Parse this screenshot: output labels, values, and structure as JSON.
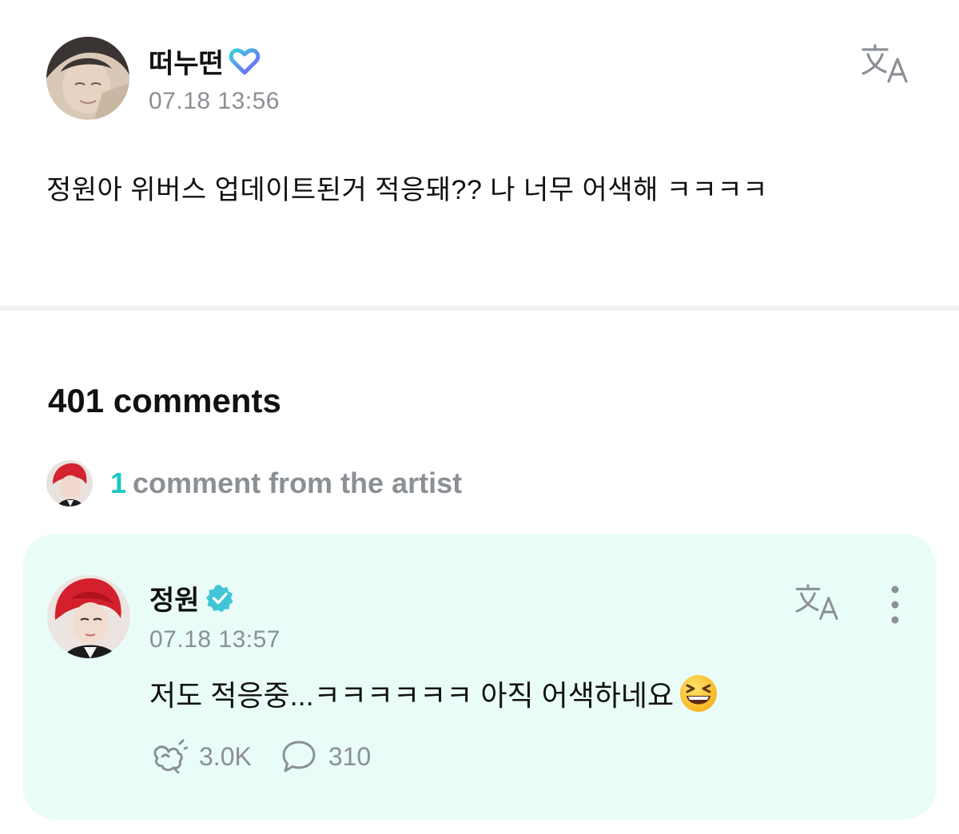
{
  "post": {
    "author": "떠누떤",
    "author_badge": "weverse-heart-icon",
    "time": "07.18 13:56",
    "body": "정원아 위버스 업데이트된거 적응돼?? 나 너무 어색해 ㅋㅋㅋㅋ",
    "translate_icon": "translate-icon"
  },
  "comments_section": {
    "count_label": "401 comments",
    "artist_summary": {
      "count": "1",
      "text": "comment from the artist"
    }
  },
  "artist_comment": {
    "author": "정원",
    "author_badge": "verified-check-icon",
    "time": "07.18 13:57",
    "body": "저도 적응중...ㅋㅋㅋㅋㅋㅋ 아직 어색하네요",
    "emoji": "grinning-squinting-face",
    "likes": "3.0K",
    "replies": "310",
    "translate_icon": "translate-icon",
    "more_icon": "more-vertical-icon"
  },
  "colors": {
    "accent": "#1bc7c2",
    "card_background": "#e9fcf8",
    "muted_text": "#8b8f96",
    "verified_badge": "#3fc5d6"
  }
}
